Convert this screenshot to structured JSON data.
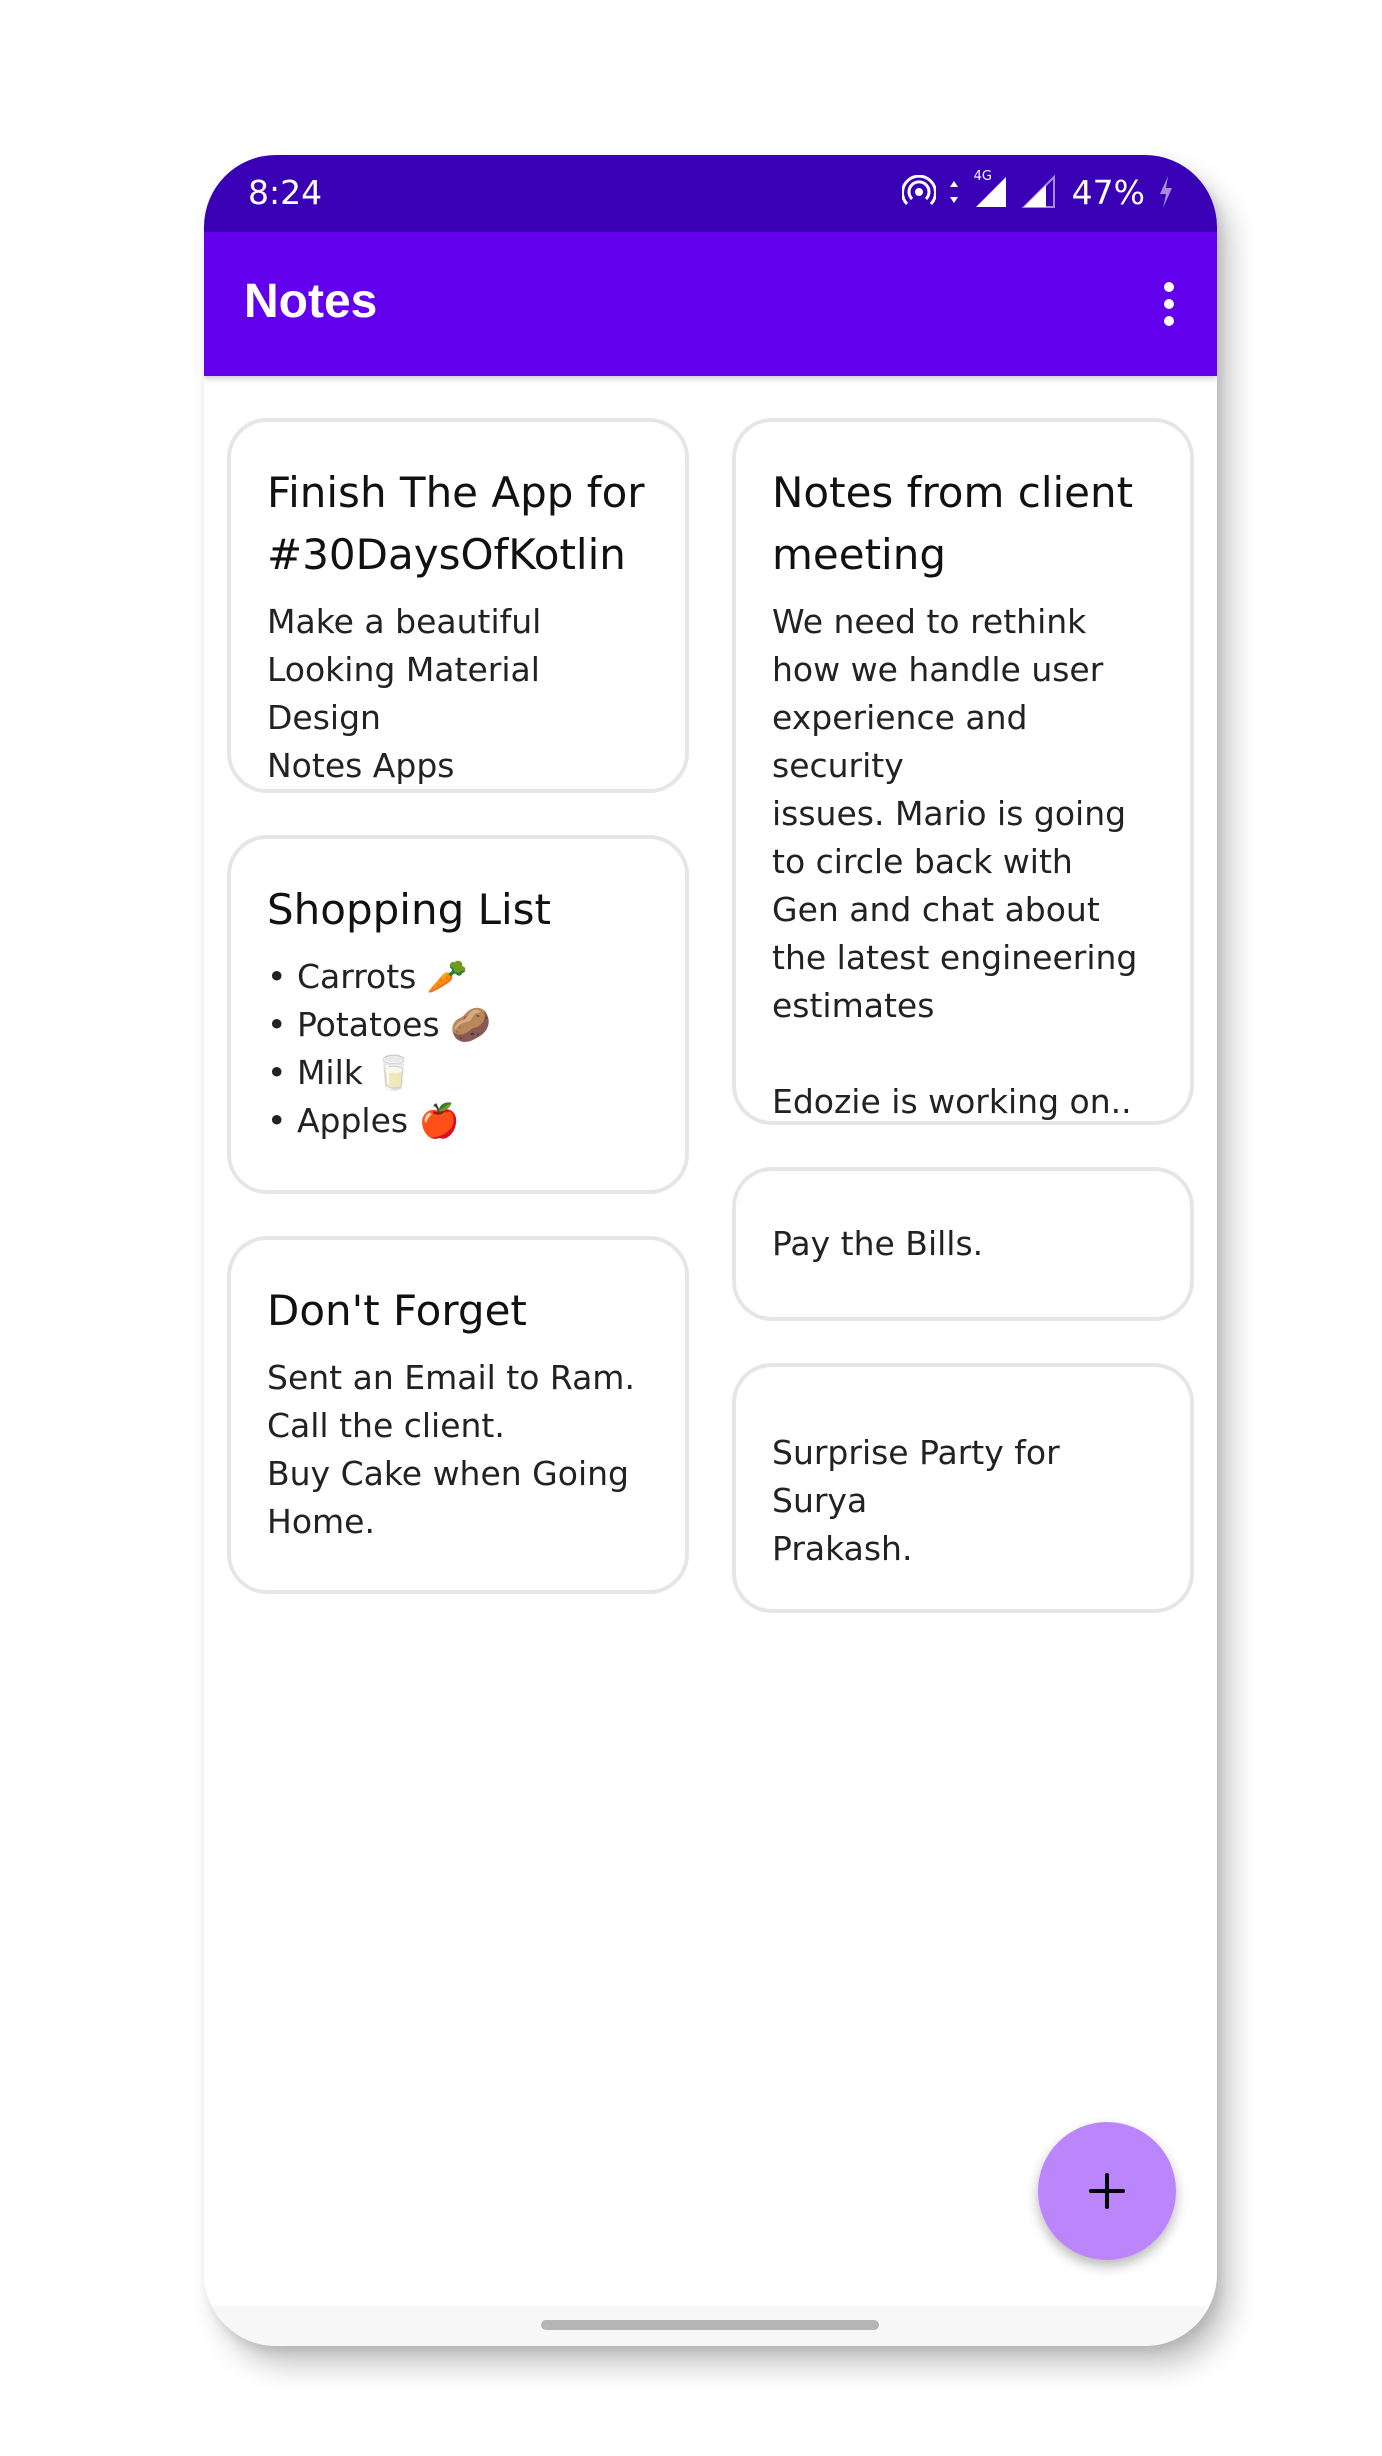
{
  "status_bar": {
    "time": "8:24",
    "network_type": "4G",
    "battery": "47%",
    "icons": [
      "hotspot-icon",
      "data-arrows-icon",
      "signal-icon",
      "signal-icon-2",
      "charging-icon"
    ]
  },
  "app_bar": {
    "title": "Notes",
    "menu_icon": "more-vert-icon"
  },
  "notes": [
    {
      "title": "Finish The App for #30DaysOfKotlin",
      "body": "Make a beautiful\nLooking Material Design\nNotes Apps"
    },
    {
      "title": "Shopping List",
      "body": "• Carrots 🥕\n• Potatoes 🥔\n• Milk 🥛\n• Apples 🍎"
    },
    {
      "title": "Don't Forget",
      "body": "Sent an Email to Ram.\nCall the client.\nBuy Cake when Going\nHome."
    },
    {
      "title": "Notes from client meeting",
      "body": "We need to rethink\nhow we handle user\nexperience and security\nissues. Mario is going\nto circle back with\nGen and chat about\nthe latest engineering\nestimates\n\nEdozie is working on.."
    },
    {
      "title": "",
      "body": "Pay the Bills."
    },
    {
      "title": "",
      "body": "Surprise Party for Surya\nPrakash."
    }
  ],
  "fab": {
    "icon": "add-icon"
  },
  "colors": {
    "status_bar": "#3a00b6",
    "app_bar": "#6200ee",
    "fab": "#bb86fc",
    "card_border": "#e6e6e6"
  }
}
